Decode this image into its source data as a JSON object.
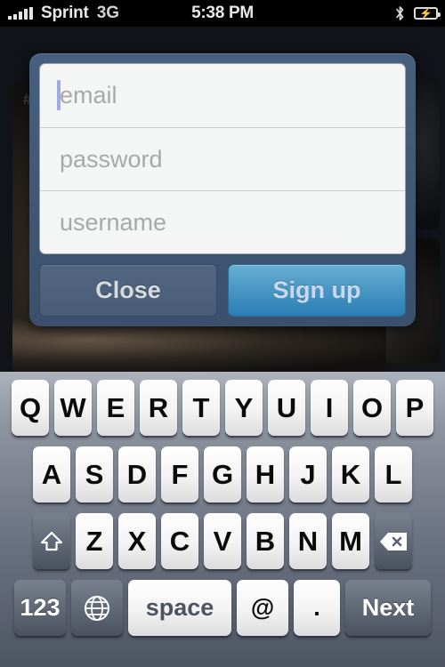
{
  "statusbar": {
    "carrier": "Sprint",
    "network": "3G",
    "time": "5:38 PM",
    "signal_icon": "signal-bars-icon",
    "bluetooth_icon": "bluetooth-icon",
    "battery_icon": "battery-charging-icon",
    "battery_bolt": "⚡"
  },
  "background": {
    "card_tag": "#"
  },
  "dialog": {
    "fields": [
      {
        "name": "email",
        "placeholder": "email",
        "value": "",
        "focused": true
      },
      {
        "name": "password",
        "placeholder": "password",
        "value": "",
        "focused": false
      },
      {
        "name": "username",
        "placeholder": "username",
        "value": "",
        "focused": false
      }
    ],
    "close_label": "Close",
    "signup_label": "Sign up",
    "frame_color": "#3f5673",
    "signup_color": "#3e92c4",
    "close_color": "#4f6481",
    "caret_color": "#9fabe2"
  },
  "keyboard": {
    "row1": [
      "Q",
      "W",
      "E",
      "R",
      "T",
      "Y",
      "U",
      "I",
      "O",
      "P"
    ],
    "row2": [
      "A",
      "S",
      "D",
      "F",
      "G",
      "H",
      "J",
      "K",
      "L"
    ],
    "row3": [
      "Z",
      "X",
      "C",
      "V",
      "B",
      "N",
      "M"
    ],
    "shift_icon": "shift-arrow-icon",
    "backspace_icon": "backspace-icon",
    "numbers_label": "123",
    "globe_icon": "globe-icon",
    "space_label": "space",
    "at_label": "@",
    "period_label": ".",
    "next_label": "Next",
    "background_color": "#6d7483"
  }
}
